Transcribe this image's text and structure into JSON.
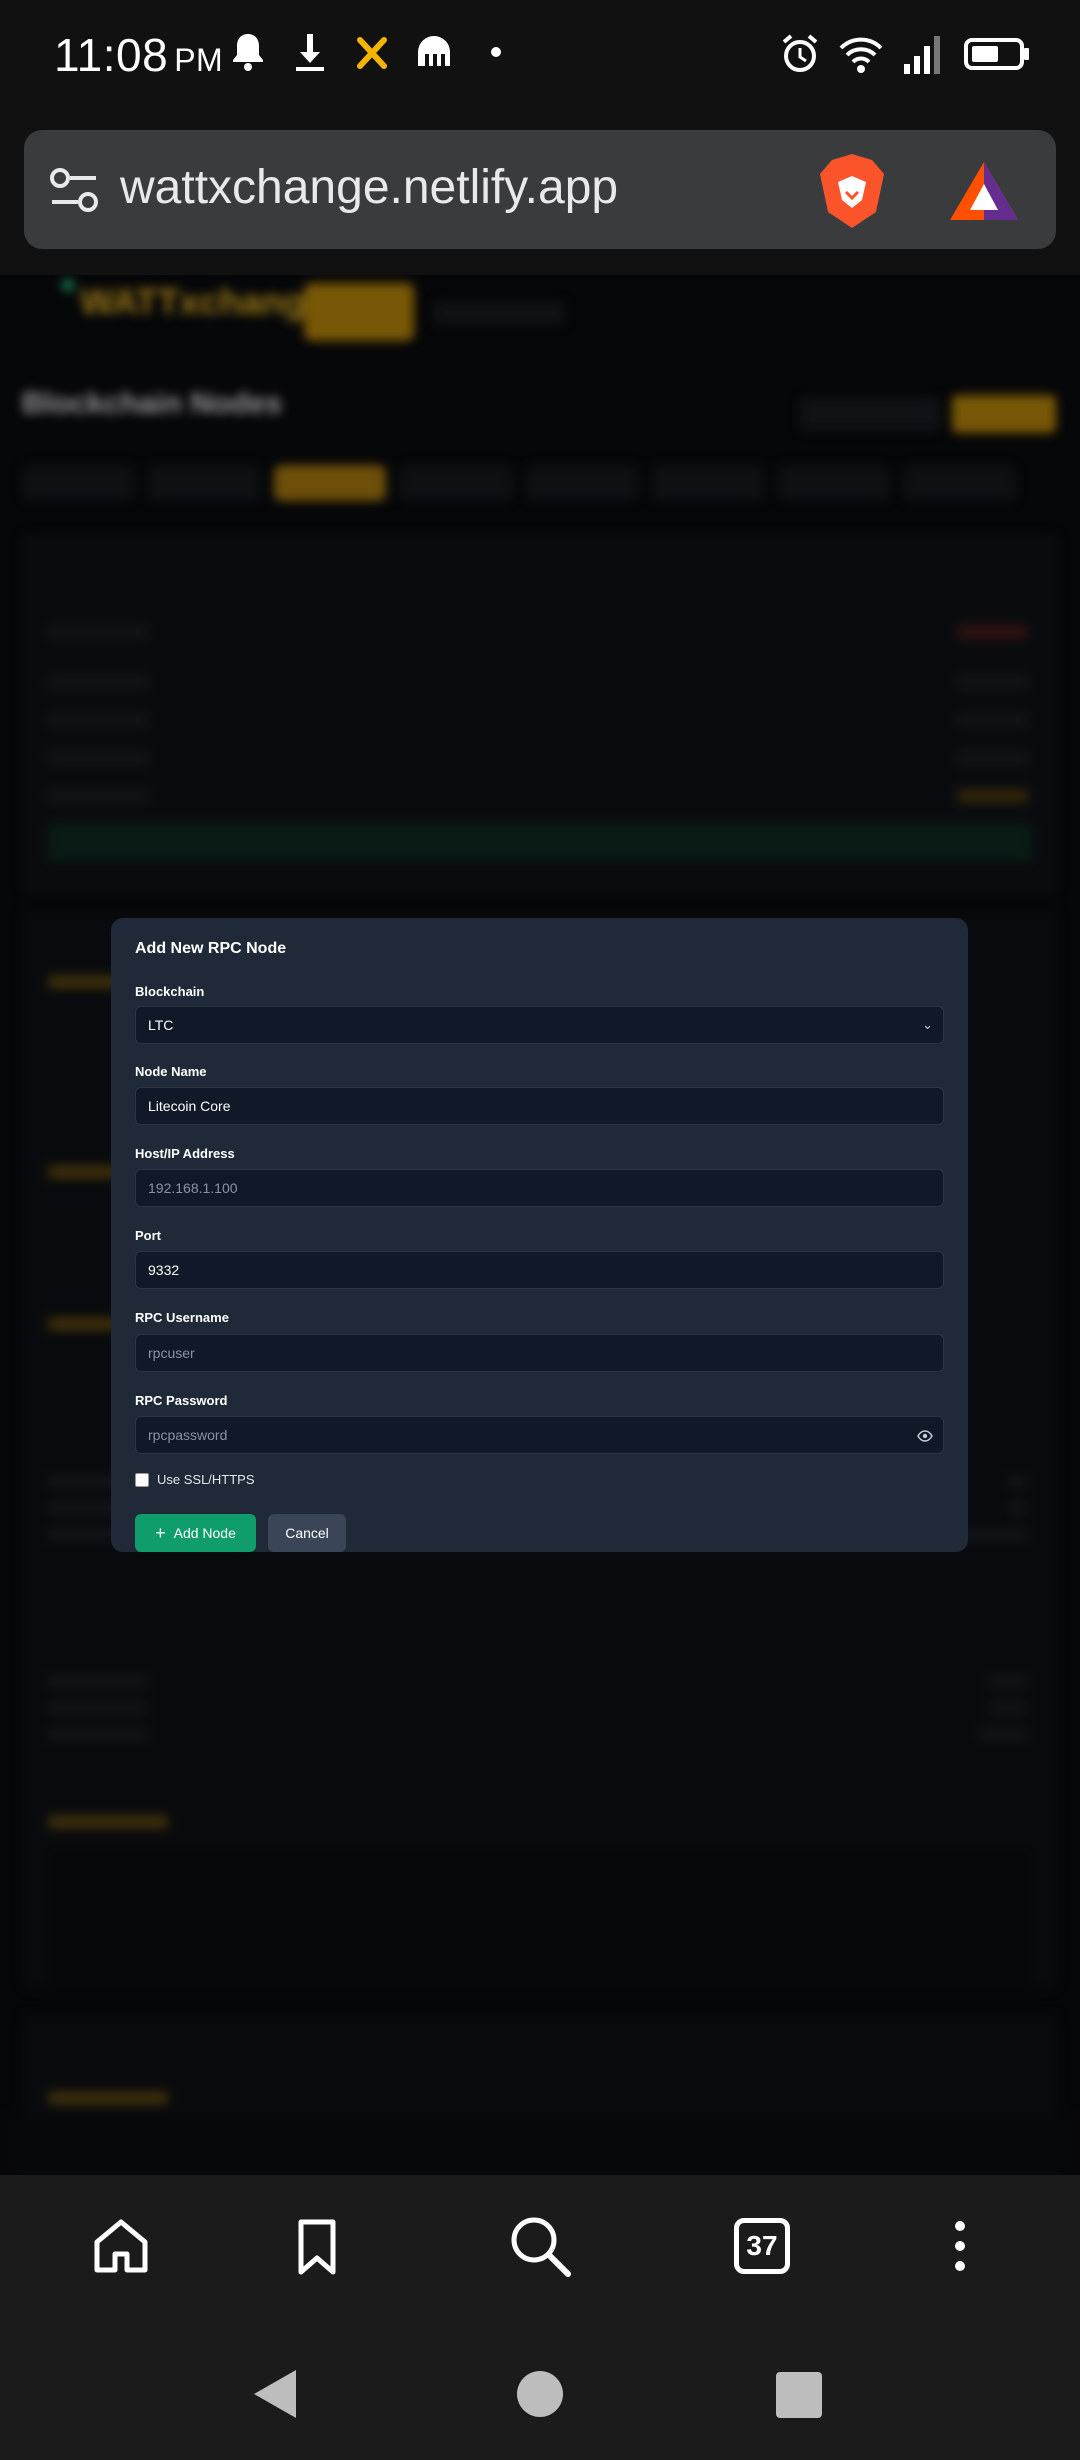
{
  "status_bar": {
    "time": "11:08",
    "ampm": "PM",
    "left_icons": [
      "bell-icon",
      "download-icon",
      "x-app-icon",
      "kraken-icon",
      "dot-icon"
    ],
    "right_icons": [
      "alarm-icon",
      "wifi-icon",
      "signal-icon",
      "battery-icon"
    ]
  },
  "browser": {
    "url": "wattxchange.netlify.app",
    "tabs_count": "37"
  },
  "modal": {
    "title": "Add New RPC Node",
    "fields": {
      "blockchain": {
        "label": "Blockchain",
        "value": "LTC"
      },
      "node_name": {
        "label": "Node Name",
        "value": "Litecoin Core"
      },
      "host": {
        "label": "Host/IP Address",
        "placeholder": "192.168.1.100"
      },
      "port": {
        "label": "Port",
        "value": "9332"
      },
      "username": {
        "label": "RPC Username",
        "placeholder": "rpcuser"
      },
      "password": {
        "label": "RPC Password",
        "placeholder": "rpcpassword"
      }
    },
    "ssl_label": "Use SSL/HTTPS",
    "ssl_checked": false,
    "add_button": "Add Node",
    "cancel_button": "Cancel"
  },
  "colors": {
    "modal_bg": "#1f2937",
    "input_bg": "#111827",
    "add_button": "#0f9d6b",
    "cancel_button": "#3a4657",
    "brand_gold": "#e6b422"
  }
}
